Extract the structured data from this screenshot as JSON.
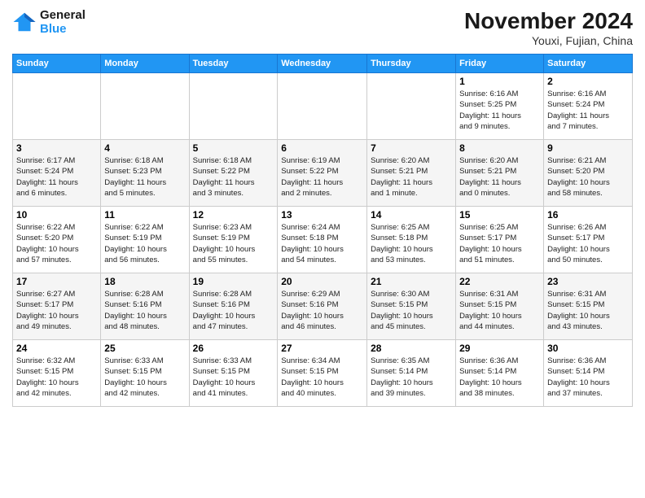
{
  "logo": {
    "line1": "General",
    "line2": "Blue"
  },
  "title": "November 2024",
  "location": "Youxi, Fujian, China",
  "days_header": [
    "Sunday",
    "Monday",
    "Tuesday",
    "Wednesday",
    "Thursday",
    "Friday",
    "Saturday"
  ],
  "weeks": [
    [
      {
        "day": "",
        "info": ""
      },
      {
        "day": "",
        "info": ""
      },
      {
        "day": "",
        "info": ""
      },
      {
        "day": "",
        "info": ""
      },
      {
        "day": "",
        "info": ""
      },
      {
        "day": "1",
        "info": "Sunrise: 6:16 AM\nSunset: 5:25 PM\nDaylight: 11 hours\nand 9 minutes."
      },
      {
        "day": "2",
        "info": "Sunrise: 6:16 AM\nSunset: 5:24 PM\nDaylight: 11 hours\nand 7 minutes."
      }
    ],
    [
      {
        "day": "3",
        "info": "Sunrise: 6:17 AM\nSunset: 5:24 PM\nDaylight: 11 hours\nand 6 minutes."
      },
      {
        "day": "4",
        "info": "Sunrise: 6:18 AM\nSunset: 5:23 PM\nDaylight: 11 hours\nand 5 minutes."
      },
      {
        "day": "5",
        "info": "Sunrise: 6:18 AM\nSunset: 5:22 PM\nDaylight: 11 hours\nand 3 minutes."
      },
      {
        "day": "6",
        "info": "Sunrise: 6:19 AM\nSunset: 5:22 PM\nDaylight: 11 hours\nand 2 minutes."
      },
      {
        "day": "7",
        "info": "Sunrise: 6:20 AM\nSunset: 5:21 PM\nDaylight: 11 hours\nand 1 minute."
      },
      {
        "day": "8",
        "info": "Sunrise: 6:20 AM\nSunset: 5:21 PM\nDaylight: 11 hours\nand 0 minutes."
      },
      {
        "day": "9",
        "info": "Sunrise: 6:21 AM\nSunset: 5:20 PM\nDaylight: 10 hours\nand 58 minutes."
      }
    ],
    [
      {
        "day": "10",
        "info": "Sunrise: 6:22 AM\nSunset: 5:20 PM\nDaylight: 10 hours\nand 57 minutes."
      },
      {
        "day": "11",
        "info": "Sunrise: 6:22 AM\nSunset: 5:19 PM\nDaylight: 10 hours\nand 56 minutes."
      },
      {
        "day": "12",
        "info": "Sunrise: 6:23 AM\nSunset: 5:19 PM\nDaylight: 10 hours\nand 55 minutes."
      },
      {
        "day": "13",
        "info": "Sunrise: 6:24 AM\nSunset: 5:18 PM\nDaylight: 10 hours\nand 54 minutes."
      },
      {
        "day": "14",
        "info": "Sunrise: 6:25 AM\nSunset: 5:18 PM\nDaylight: 10 hours\nand 53 minutes."
      },
      {
        "day": "15",
        "info": "Sunrise: 6:25 AM\nSunset: 5:17 PM\nDaylight: 10 hours\nand 51 minutes."
      },
      {
        "day": "16",
        "info": "Sunrise: 6:26 AM\nSunset: 5:17 PM\nDaylight: 10 hours\nand 50 minutes."
      }
    ],
    [
      {
        "day": "17",
        "info": "Sunrise: 6:27 AM\nSunset: 5:17 PM\nDaylight: 10 hours\nand 49 minutes."
      },
      {
        "day": "18",
        "info": "Sunrise: 6:28 AM\nSunset: 5:16 PM\nDaylight: 10 hours\nand 48 minutes."
      },
      {
        "day": "19",
        "info": "Sunrise: 6:28 AM\nSunset: 5:16 PM\nDaylight: 10 hours\nand 47 minutes."
      },
      {
        "day": "20",
        "info": "Sunrise: 6:29 AM\nSunset: 5:16 PM\nDaylight: 10 hours\nand 46 minutes."
      },
      {
        "day": "21",
        "info": "Sunrise: 6:30 AM\nSunset: 5:15 PM\nDaylight: 10 hours\nand 45 minutes."
      },
      {
        "day": "22",
        "info": "Sunrise: 6:31 AM\nSunset: 5:15 PM\nDaylight: 10 hours\nand 44 minutes."
      },
      {
        "day": "23",
        "info": "Sunrise: 6:31 AM\nSunset: 5:15 PM\nDaylight: 10 hours\nand 43 minutes."
      }
    ],
    [
      {
        "day": "24",
        "info": "Sunrise: 6:32 AM\nSunset: 5:15 PM\nDaylight: 10 hours\nand 42 minutes."
      },
      {
        "day": "25",
        "info": "Sunrise: 6:33 AM\nSunset: 5:15 PM\nDaylight: 10 hours\nand 42 minutes."
      },
      {
        "day": "26",
        "info": "Sunrise: 6:33 AM\nSunset: 5:15 PM\nDaylight: 10 hours\nand 41 minutes."
      },
      {
        "day": "27",
        "info": "Sunrise: 6:34 AM\nSunset: 5:15 PM\nDaylight: 10 hours\nand 40 minutes."
      },
      {
        "day": "28",
        "info": "Sunrise: 6:35 AM\nSunset: 5:14 PM\nDaylight: 10 hours\nand 39 minutes."
      },
      {
        "day": "29",
        "info": "Sunrise: 6:36 AM\nSunset: 5:14 PM\nDaylight: 10 hours\nand 38 minutes."
      },
      {
        "day": "30",
        "info": "Sunrise: 6:36 AM\nSunset: 5:14 PM\nDaylight: 10 hours\nand 37 minutes."
      }
    ]
  ]
}
